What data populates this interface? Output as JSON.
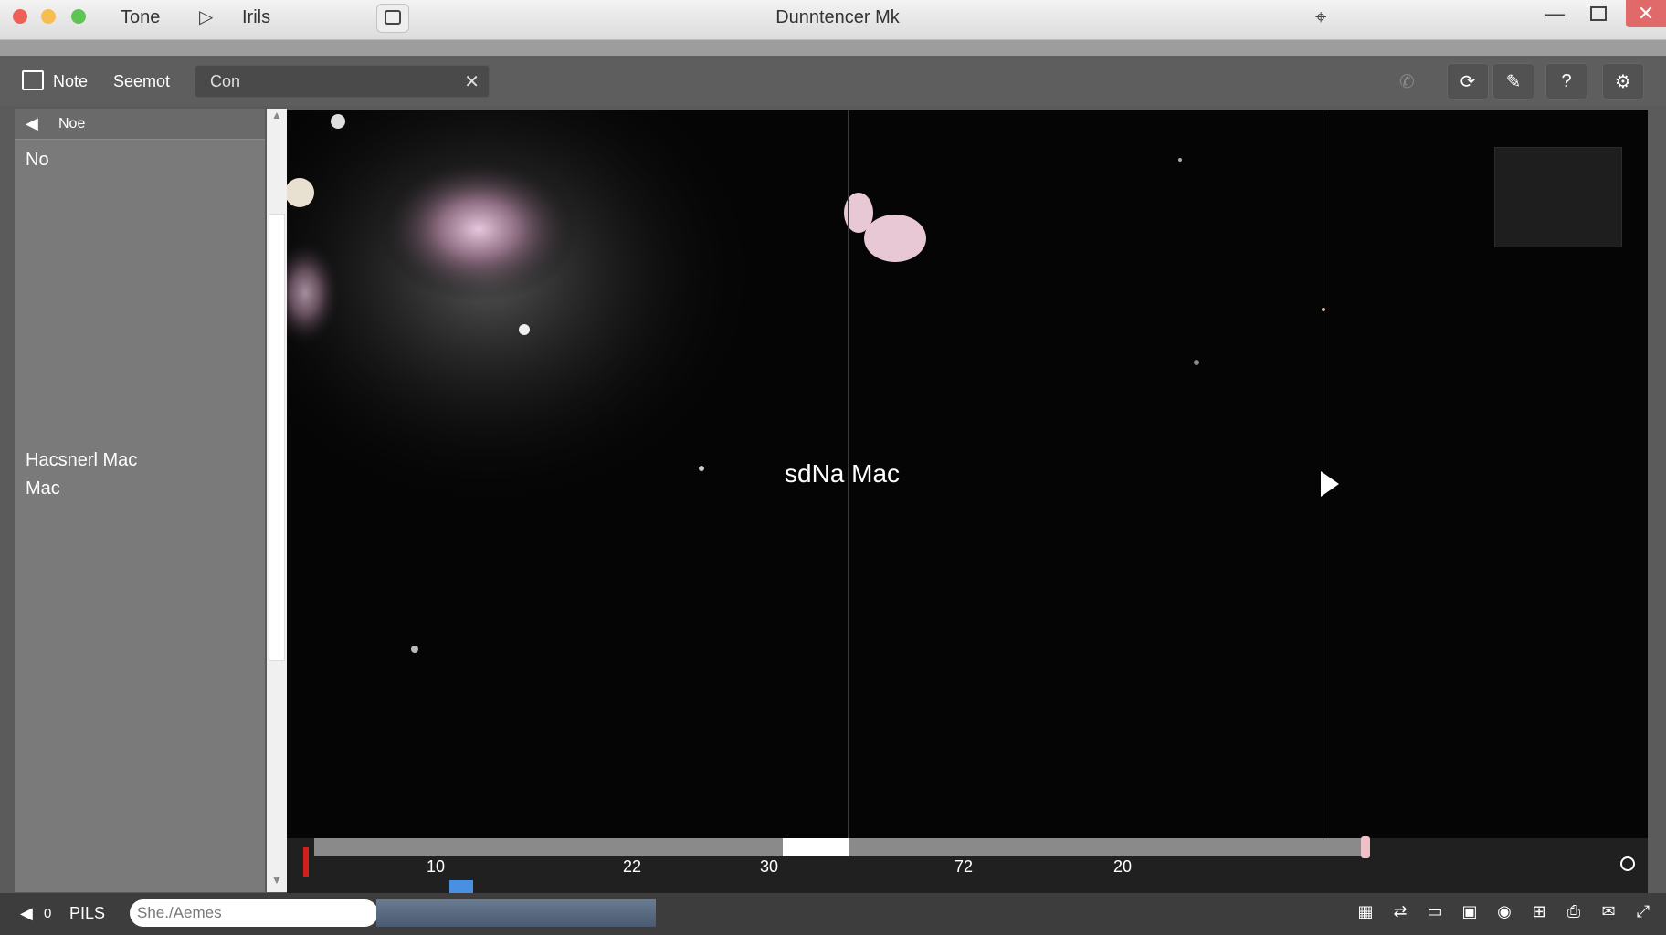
{
  "window": {
    "title": "Dunntencer Mk",
    "menu": [
      "Tone",
      "Irils"
    ]
  },
  "toolbar": {
    "items": [
      "Note",
      "Seemot"
    ],
    "search_value": "Con"
  },
  "sidebar": {
    "header": "Noe",
    "no_label": "No",
    "bottom_text_line1": "Hacsnerl Mac",
    "bottom_text_line2": "Mac"
  },
  "viewer": {
    "center_label": "sdNa Mac"
  },
  "timeline": {
    "ticks": [
      "10",
      "22",
      "30",
      "72",
      "20"
    ]
  },
  "statusbar": {
    "volume": "0",
    "mode": "PILS",
    "path": "She./Aemes"
  },
  "colors": {
    "close": "#e06a6a",
    "playhead": "#d02020",
    "marker": "#4a90e2"
  }
}
